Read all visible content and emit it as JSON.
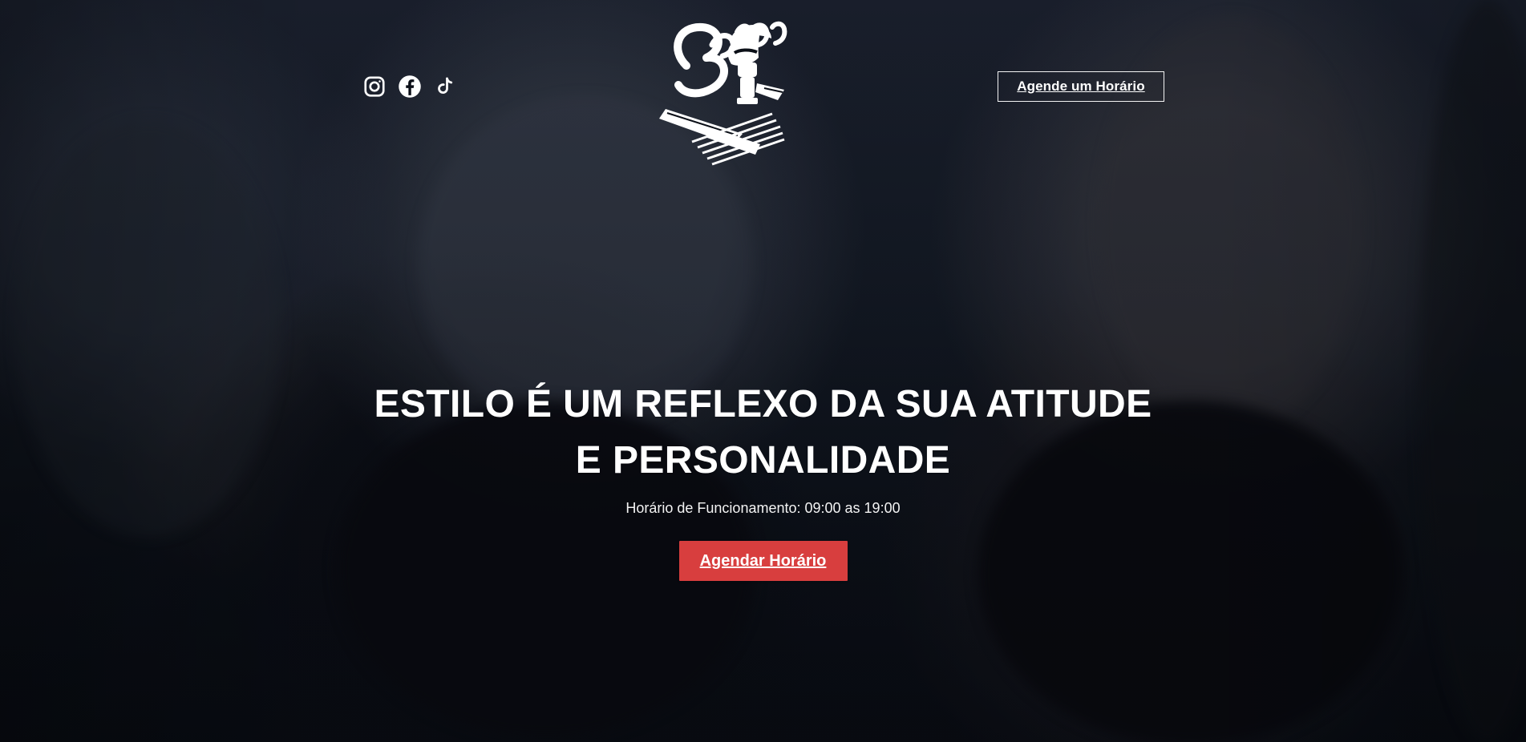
{
  "brand": {
    "logo_text": "Barber"
  },
  "header": {
    "social_icons": [
      "instagram-icon",
      "facebook-icon",
      "tiktok-icon"
    ],
    "cta_label": "Agende um Horário"
  },
  "hero": {
    "headline_line_1": "ESTILO É UM REFLEXO DA SUA ATITUDE",
    "headline_line_2": "E PERSONALIDADE",
    "hours": "Horário de Funcionamento: 09:00 as 19:00",
    "cta_label": "Agendar Horário"
  },
  "colors": {
    "accent": "#d83e3e",
    "text": "#ffffff",
    "background": "#0b0f17"
  }
}
